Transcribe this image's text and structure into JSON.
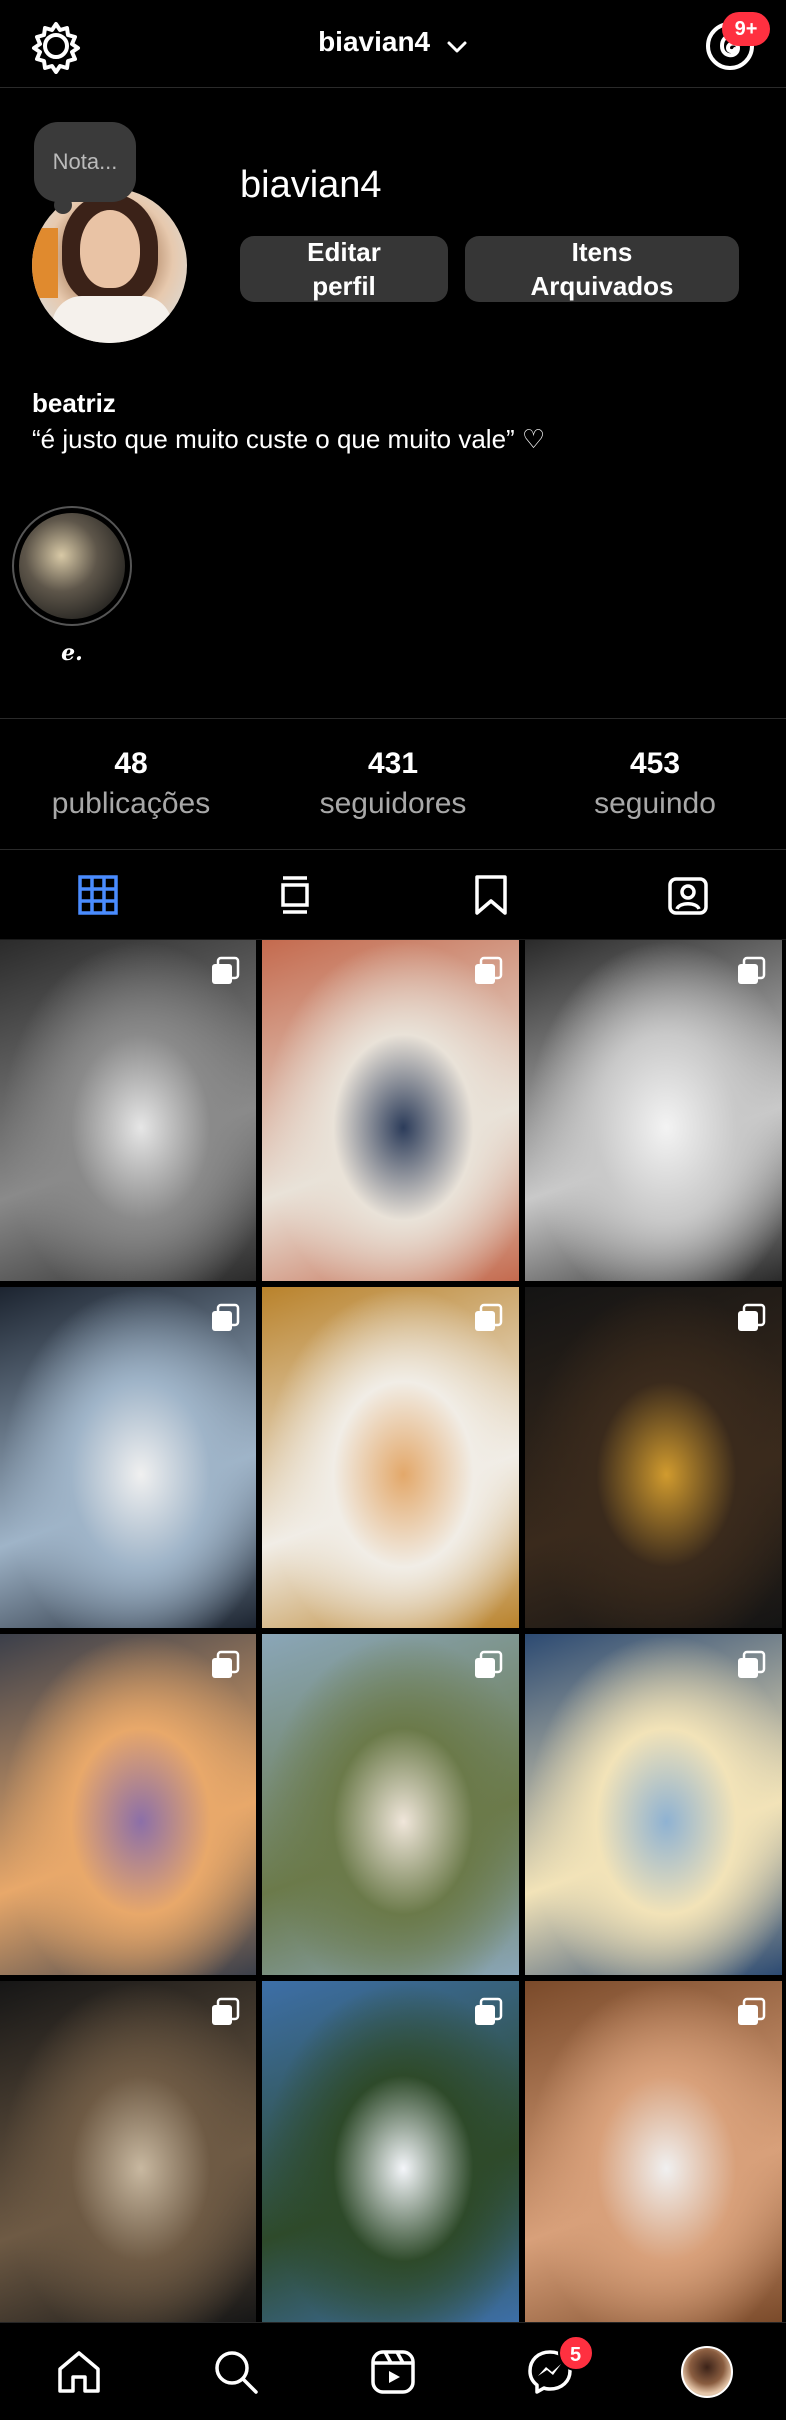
{
  "topbar": {
    "username": "biavian4",
    "threads_badge": "9+",
    "icons": [
      "settings-icon",
      "chevron-down-icon",
      "threads-icon"
    ]
  },
  "profile": {
    "note_placeholder": "Nota...",
    "username": "biavian4",
    "edit_button": "Editar perfil",
    "archive_button": "Itens Arquivados",
    "bio_name": "beatriz",
    "bio_text": "“é justo que muito custe o que muito vale” ♡"
  },
  "highlights": [
    {
      "label": "𝒆."
    }
  ],
  "stats": [
    {
      "value": "48",
      "label": "publicações"
    },
    {
      "value": "431",
      "label": "seguidores"
    },
    {
      "value": "453",
      "label": "seguindo"
    }
  ],
  "tabs": [
    {
      "icon": "grid-icon",
      "active": true
    },
    {
      "icon": "reels-feed-icon",
      "active": false
    },
    {
      "icon": "bookmark-icon",
      "active": false
    },
    {
      "icon": "tagged-icon",
      "active": false
    }
  ],
  "posts": [
    {
      "subject": "bride in car",
      "multi": true,
      "colors": [
        "#2b2b2b",
        "#8a8a8a",
        "#e6e6e6"
      ]
    },
    {
      "subject": "couple wedding exit",
      "multi": true,
      "colors": [
        "#c46a4e",
        "#e9e2d8",
        "#2c3c5a"
      ]
    },
    {
      "subject": "wedding ceremony black and white",
      "multi": true,
      "colors": [
        "#2a2a2a",
        "#c9c9c9",
        "#f3f3f3"
      ]
    },
    {
      "subject": "woman in car selfie",
      "multi": true,
      "colors": [
        "#1c2430",
        "#9fb4c8",
        "#f0f0f0"
      ]
    },
    {
      "subject": "couple holding hands",
      "multi": true,
      "colors": [
        "#b9822b",
        "#f1ede6",
        "#e3a86a"
      ]
    },
    {
      "subject": "woman in car with floral top",
      "multi": true,
      "colors": [
        "#141414",
        "#3a2a1c",
        "#d19b2e"
      ]
    },
    {
      "subject": "couple at sunset beach",
      "multi": true,
      "colors": [
        "#3b3f4a",
        "#e8a86a",
        "#8c6fa8"
      ]
    },
    {
      "subject": "woman by lake",
      "multi": true,
      "colors": [
        "#8aa6b8",
        "#6b7a4a",
        "#f0e6da"
      ]
    },
    {
      "subject": "woman at sunset sea",
      "multi": true,
      "colors": [
        "#2c4a72",
        "#f2e3b8",
        "#8fb2d2"
      ]
    },
    {
      "subject": "window with hammock",
      "multi": true,
      "colors": [
        "#161616",
        "#6e5a44",
        "#c8b8a0"
      ]
    },
    {
      "subject": "woman in white dress outdoors",
      "multi": true,
      "colors": [
        "#3d6fa8",
        "#2e4a2a",
        "#f4f6fa"
      ]
    },
    {
      "subject": "couple with cups",
      "multi": true,
      "colors": [
        "#7a4a2a",
        "#d8a07a",
        "#f0f0f0"
      ]
    }
  ],
  "bottom_nav": [
    {
      "icon": "home-icon"
    },
    {
      "icon": "search-icon"
    },
    {
      "icon": "reels-icon"
    },
    {
      "icon": "messenger-icon",
      "badge": "5"
    },
    {
      "icon": "profile-avatar"
    }
  ],
  "colors": {
    "background": "#000000",
    "button": "#363636",
    "badge": "#ff3040",
    "active_tab": "#4a8cff",
    "muted_text": "#a8a8a8"
  }
}
